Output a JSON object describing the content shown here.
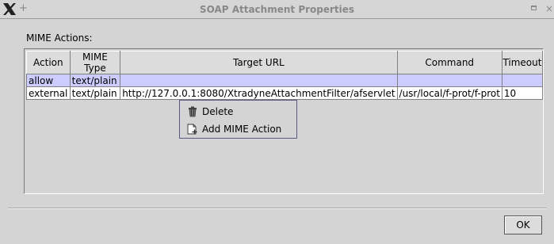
{
  "window": {
    "title": "SOAP Attachment Properties",
    "pin_glyph": "+",
    "close_glyph": "×"
  },
  "section_label": "MIME Actions:",
  "table": {
    "columns": [
      "Action",
      "MIME Type",
      "Target URL",
      "Command",
      "Timeout"
    ],
    "rows": [
      [
        "allow",
        "text/plain",
        "",
        "",
        ""
      ],
      [
        "external",
        "text/plain",
        "http://127.0.0.1:8080/XtradyneAttachmentFilter/afservlet",
        "/usr/local/f-prot/f-prot",
        "10"
      ]
    ],
    "selected_row": 0
  },
  "context_menu": {
    "items": [
      {
        "label": "Delete",
        "icon": "trash-icon"
      },
      {
        "label": "Add MIME Action",
        "icon": "add-document-icon"
      }
    ]
  },
  "buttons": {
    "ok": "OK"
  },
  "colors": {
    "selection": "#ccccff",
    "background": "#d4d4d4"
  }
}
